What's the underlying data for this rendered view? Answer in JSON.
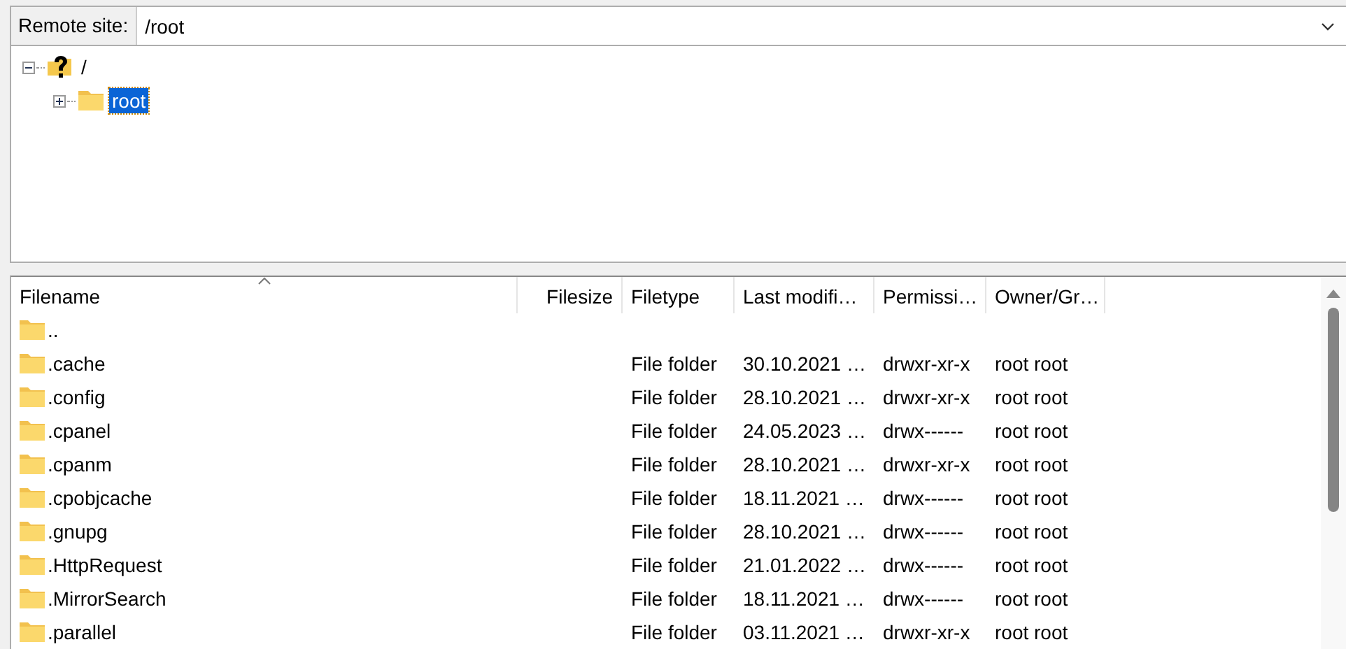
{
  "remote_site": {
    "label": "Remote site:",
    "path": "/root"
  },
  "tree": [
    {
      "name": "/",
      "expanded": true,
      "selected": false,
      "children": [
        {
          "name": "root",
          "expanded": false,
          "selected": true
        }
      ]
    }
  ],
  "file_list": {
    "columns": [
      {
        "label": "Filename",
        "sorted": true
      },
      {
        "label": "Filesize",
        "sorted": false
      },
      {
        "label": "Filetype",
        "sorted": false
      },
      {
        "label": "Last modifi…",
        "sorted": false
      },
      {
        "label": "Permissi…",
        "sorted": false
      },
      {
        "label": "Owner/Gr…",
        "sorted": false
      }
    ],
    "rows": [
      {
        "filename": ".."
      },
      {
        "filename": ".cache",
        "filetype": "File folder",
        "modified": "30.10.2021 …",
        "permissions": "drwxr-xr-x",
        "owner": "root root"
      },
      {
        "filename": ".config",
        "filetype": "File folder",
        "modified": "28.10.2021 …",
        "permissions": "drwxr-xr-x",
        "owner": "root root"
      },
      {
        "filename": ".cpanel",
        "filetype": "File folder",
        "modified": "24.05.2023 …",
        "permissions": "drwx------",
        "owner": "root root"
      },
      {
        "filename": ".cpanm",
        "filetype": "File folder",
        "modified": "28.10.2021 …",
        "permissions": "drwxr-xr-x",
        "owner": "root root"
      },
      {
        "filename": ".cpobjcache",
        "filetype": "File folder",
        "modified": "18.11.2021 …",
        "permissions": "drwx------",
        "owner": "root root"
      },
      {
        "filename": ".gnupg",
        "filetype": "File folder",
        "modified": "28.10.2021 …",
        "permissions": "drwx------",
        "owner": "root root"
      },
      {
        "filename": ".HttpRequest",
        "filetype": "File folder",
        "modified": "21.01.2022 …",
        "permissions": "drwx------",
        "owner": "root root"
      },
      {
        "filename": ".MirrorSearch",
        "filetype": "File folder",
        "modified": "18.11.2021 …",
        "permissions": "drwx------",
        "owner": "root root"
      },
      {
        "filename": ".parallel",
        "filetype": "File folder",
        "modified": "03.11.2021 …",
        "permissions": "drwxr-xr-x",
        "owner": "root root"
      }
    ]
  }
}
